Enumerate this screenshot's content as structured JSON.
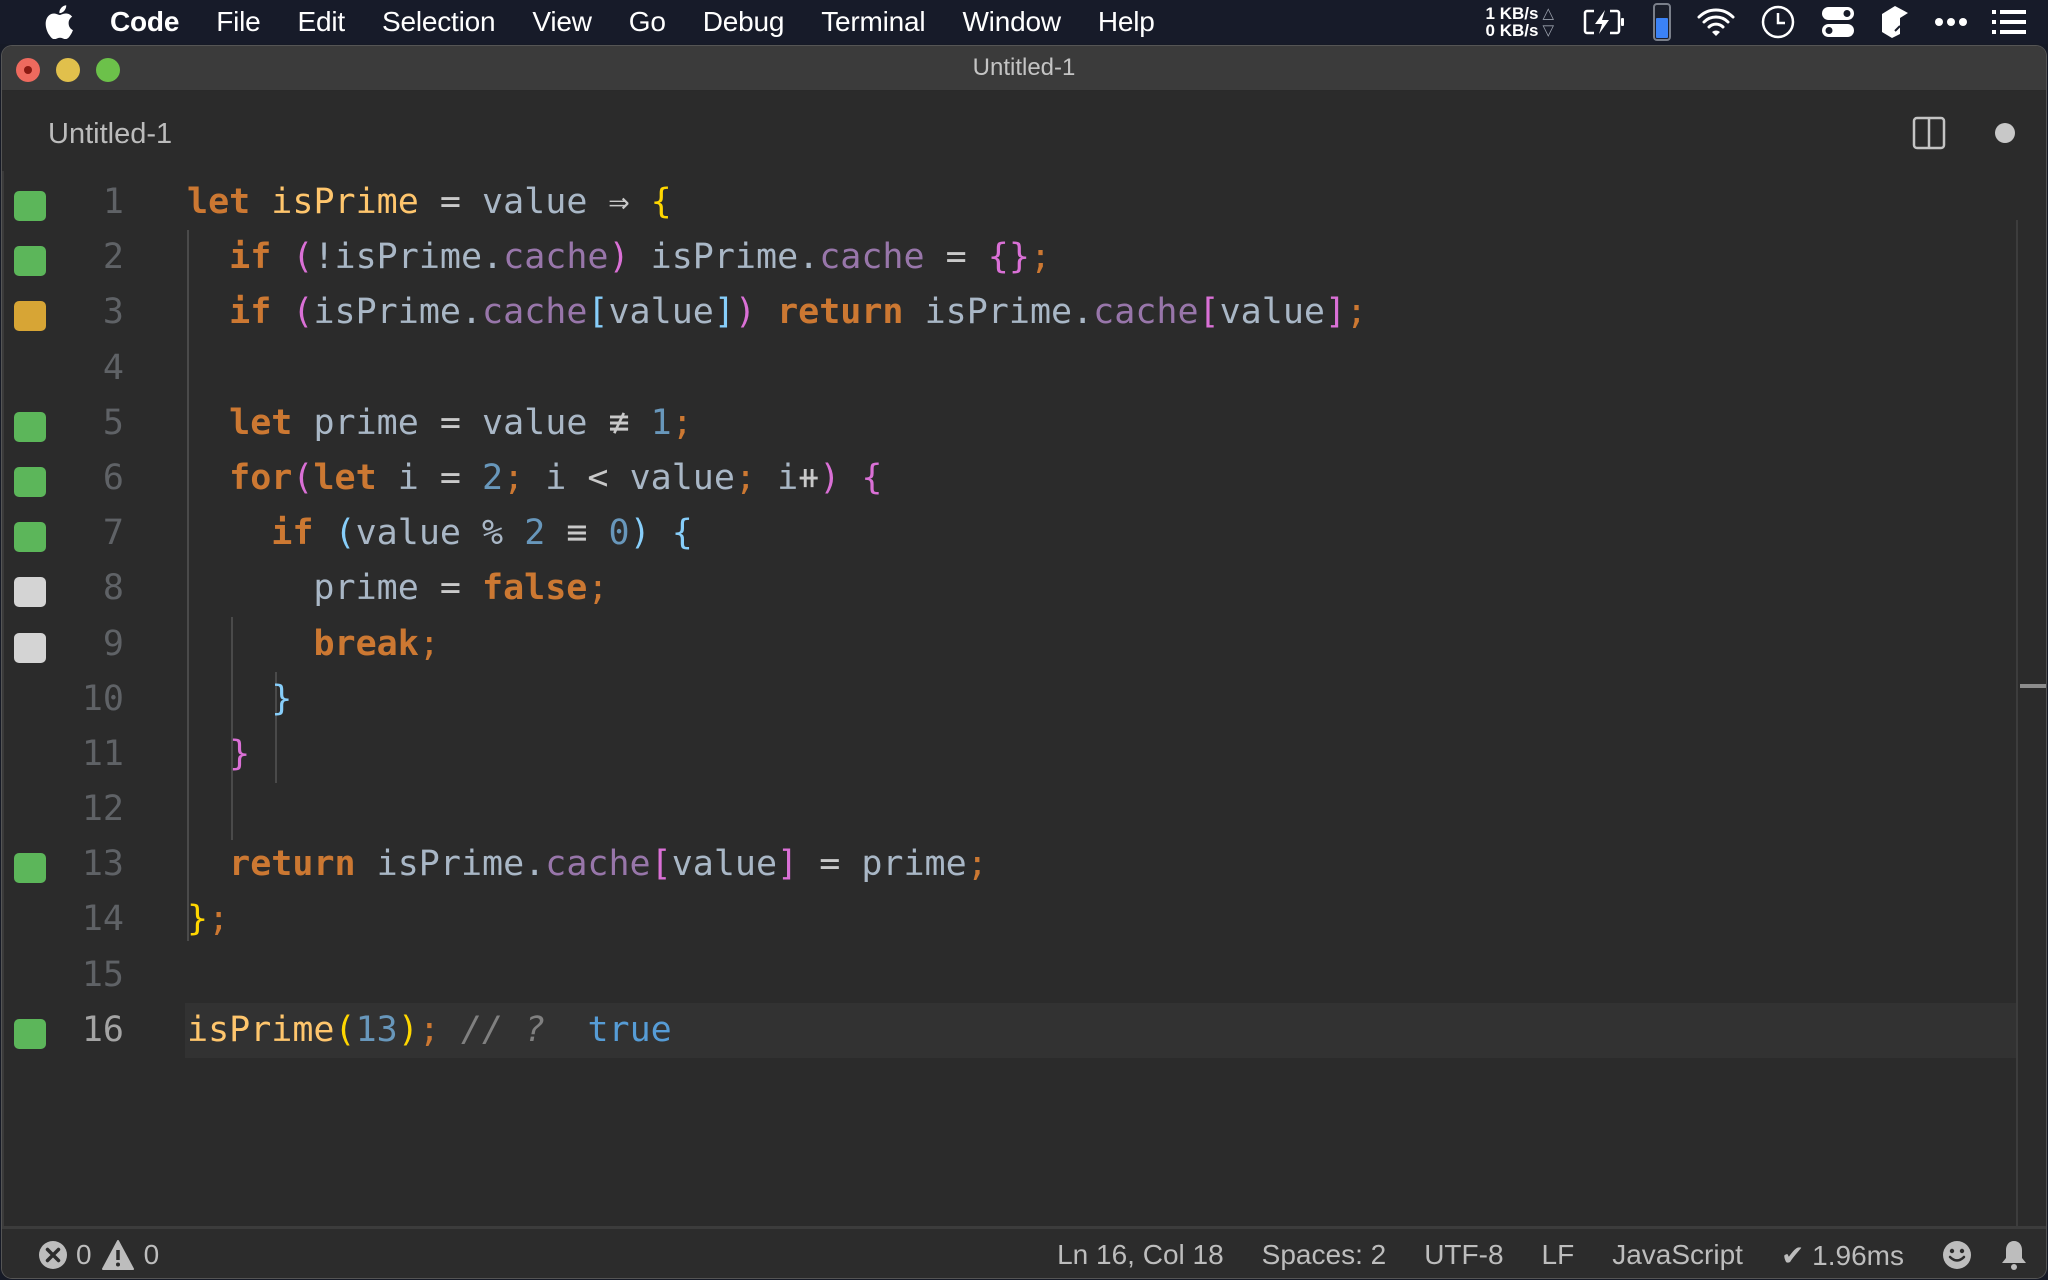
{
  "menubar": {
    "app_name": "Code",
    "items": [
      "File",
      "Edit",
      "Selection",
      "View",
      "Go",
      "Debug",
      "Terminal",
      "Window",
      "Help"
    ],
    "net_up": "1 KB/s",
    "net_down": "0 KB/s",
    "up_arrow": "△",
    "down_arrow": "▽",
    "tray_icons": [
      "battery-charging-icon",
      "battery-level-icon",
      "wifi-icon",
      "clock-icon",
      "control-toggle-icon",
      "app-cube-icon",
      "more-dots-icon",
      "list-menu-icon"
    ]
  },
  "window": {
    "title": "Untitled-1"
  },
  "tab": {
    "label": "Untitled-1",
    "dirty": true
  },
  "colors": {
    "keyword": "#cc7832",
    "function_name": "#ffc66d",
    "identifier": "#a9b7c6",
    "property": "#9876aa",
    "number": "#6897bb",
    "comment": "#808080",
    "coverage_covered": "#5cb65a",
    "coverage_partial": "#d7a535",
    "coverage_uncovered": "#d4d4d4"
  },
  "editor": {
    "lines": [
      {
        "n": "1",
        "coverage": "covered"
      },
      {
        "n": "2",
        "coverage": "covered"
      },
      {
        "n": "3",
        "coverage": "partial"
      },
      {
        "n": "4",
        "coverage": "none"
      },
      {
        "n": "5",
        "coverage": "covered"
      },
      {
        "n": "6",
        "coverage": "covered"
      },
      {
        "n": "7",
        "coverage": "covered"
      },
      {
        "n": "8",
        "coverage": "uncovered"
      },
      {
        "n": "9",
        "coverage": "uncovered"
      },
      {
        "n": "10",
        "coverage": "none"
      },
      {
        "n": "11",
        "coverage": "none"
      },
      {
        "n": "12",
        "coverage": "none"
      },
      {
        "n": "13",
        "coverage": "covered"
      },
      {
        "n": "14",
        "coverage": "none"
      },
      {
        "n": "15",
        "coverage": "none"
      },
      {
        "n": "16",
        "coverage": "covered"
      }
    ],
    "code": [
      [
        [
          "kw",
          "let"
        ],
        [
          "id",
          " "
        ],
        [
          "fn",
          "isPrime"
        ],
        [
          "op",
          " = "
        ],
        [
          "id",
          "value"
        ],
        [
          "op",
          " ⇒ "
        ],
        [
          "b1",
          "{"
        ]
      ],
      [
        [
          "id",
          "  "
        ],
        [
          "kw",
          "if"
        ],
        [
          "id",
          " "
        ],
        [
          "b2",
          "("
        ],
        [
          "id",
          "!isPrime."
        ],
        [
          "prop",
          "cache"
        ],
        [
          "b2",
          ")"
        ],
        [
          "id",
          " isPrime."
        ],
        [
          "prop",
          "cache"
        ],
        [
          "op",
          " = "
        ],
        [
          "b2",
          "{}"
        ],
        [
          "punc",
          ";"
        ]
      ],
      [
        [
          "id",
          "  "
        ],
        [
          "kw",
          "if"
        ],
        [
          "id",
          " "
        ],
        [
          "b2",
          "("
        ],
        [
          "id",
          "isPrime."
        ],
        [
          "prop",
          "cache"
        ],
        [
          "b3",
          "["
        ],
        [
          "id",
          "value"
        ],
        [
          "b3",
          "]"
        ],
        [
          "b2",
          ")"
        ],
        [
          "id",
          " "
        ],
        [
          "kw",
          "return"
        ],
        [
          "id",
          " isPrime."
        ],
        [
          "prop",
          "cache"
        ],
        [
          "b2",
          "["
        ],
        [
          "id",
          "value"
        ],
        [
          "b2",
          "]"
        ],
        [
          "punc",
          ";"
        ]
      ],
      [],
      [
        [
          "id",
          "  "
        ],
        [
          "kw",
          "let"
        ],
        [
          "id",
          " prime"
        ],
        [
          "op",
          " = "
        ],
        [
          "id",
          "value"
        ],
        [
          "op",
          " ≢ "
        ],
        [
          "num",
          "1"
        ],
        [
          "punc",
          ";"
        ]
      ],
      [
        [
          "id",
          "  "
        ],
        [
          "kw",
          "for"
        ],
        [
          "b2",
          "("
        ],
        [
          "kw",
          "let"
        ],
        [
          "id",
          " i"
        ],
        [
          "op",
          " = "
        ],
        [
          "num",
          "2"
        ],
        [
          "punc",
          ";"
        ],
        [
          "id",
          " i "
        ],
        [
          "op",
          "<"
        ],
        [
          "id",
          " value"
        ],
        [
          "punc",
          ";"
        ],
        [
          "id",
          " i"
        ],
        [
          "op",
          "⧺"
        ],
        [
          "b2",
          ")"
        ],
        [
          "id",
          " "
        ],
        [
          "b2",
          "{"
        ]
      ],
      [
        [
          "id",
          "    "
        ],
        [
          "kw",
          "if"
        ],
        [
          "id",
          " "
        ],
        [
          "b3",
          "("
        ],
        [
          "id",
          "value % "
        ],
        [
          "num",
          "2"
        ],
        [
          "op",
          " ≡ "
        ],
        [
          "num",
          "0"
        ],
        [
          "b3",
          ")"
        ],
        [
          "id",
          " "
        ],
        [
          "b3",
          "{"
        ]
      ],
      [
        [
          "id",
          "      prime"
        ],
        [
          "op",
          " = "
        ],
        [
          "kw",
          "false"
        ],
        [
          "punc",
          ";"
        ]
      ],
      [
        [
          "id",
          "      "
        ],
        [
          "kw",
          "break"
        ],
        [
          "punc",
          ";"
        ]
      ],
      [
        [
          "id",
          "    "
        ],
        [
          "b3",
          "}"
        ]
      ],
      [
        [
          "id",
          "  "
        ],
        [
          "b2",
          "}"
        ]
      ],
      [],
      [
        [
          "id",
          "  "
        ],
        [
          "kw",
          "return"
        ],
        [
          "id",
          " isPrime."
        ],
        [
          "prop",
          "cache"
        ],
        [
          "b2",
          "["
        ],
        [
          "id",
          "value"
        ],
        [
          "b2",
          "]"
        ],
        [
          "op",
          " = "
        ],
        [
          "id",
          "prime"
        ],
        [
          "punc",
          ";"
        ]
      ],
      [
        [
          "b1",
          "}"
        ],
        [
          "punc",
          ";"
        ]
      ],
      [],
      [
        [
          "fn",
          "isPrime"
        ],
        [
          "b1",
          "("
        ],
        [
          "num",
          "13"
        ],
        [
          "b1",
          ")"
        ],
        [
          "punc",
          ";"
        ],
        [
          "id",
          " "
        ],
        [
          "cm",
          "// ?"
        ],
        [
          "id",
          "  "
        ],
        [
          "res",
          "true"
        ]
      ]
    ],
    "current_line": 16
  },
  "statusbar": {
    "errors": "0",
    "warnings": "0",
    "cursor_position": "Ln 16, Col 18",
    "indentation": "Spaces: 2",
    "encoding": "UTF-8",
    "line_ending": "LF",
    "language": "JavaScript",
    "timing": "✔ 1.96ms"
  }
}
